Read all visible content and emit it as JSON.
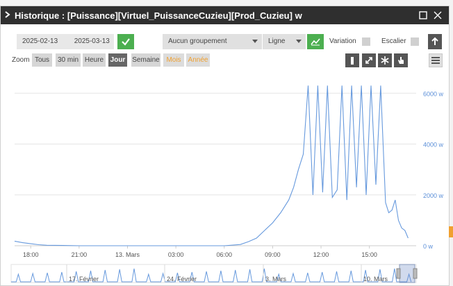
{
  "window": {
    "title": "Historique : [Puissance][Virtuel_PuissanceCuzieu][Prod_Cuzieu] w"
  },
  "filters": {
    "start_date": "2025-02-13",
    "end_date": "2025-03-13",
    "grouping": "Aucun groupement",
    "chart_style": "Ligne",
    "variation_label": "Variation",
    "stair_label": "Escalier"
  },
  "zoom": {
    "label": "Zoom",
    "buttons": [
      "Tous",
      "30 min",
      "Heure",
      "Jour",
      "Semaine",
      "Mois",
      "Année"
    ],
    "active": "Jour"
  },
  "colors": {
    "series": "#6699dd",
    "accent": "#4caf50",
    "title_bg": "#2f2f2f"
  },
  "icons": [
    "chevron-right-icon",
    "maximize-icon",
    "close-icon",
    "check-icon",
    "line-chart-icon",
    "arrow-up-icon",
    "bar-icon",
    "compress-icon",
    "snowflake-icon",
    "hand-icon",
    "menu-icon"
  ],
  "chart_data": {
    "type": "line",
    "title": "",
    "xlabel": "",
    "ylabel": "",
    "x_ticks": [
      "18:00",
      "21:00",
      "13. Mars",
      "03:00",
      "06:00",
      "09:00",
      "12:00",
      "15:00"
    ],
    "y_ticks": [
      "0 w",
      "2000 w",
      "4000 w",
      "6000 w"
    ],
    "ylim": [
      0,
      6500
    ],
    "unit": "w",
    "navigator_ticks": [
      "17. Février",
      "24. Février",
      "3. Mars",
      "10. Mars"
    ],
    "series": [
      {
        "x": [
          -4.0,
          -3.5,
          -3.0,
          -2.5,
          -2.0,
          -1.0,
          0.0,
          1.0,
          2.0,
          3.0,
          4.0,
          5.0,
          6.0,
          7.0,
          8.0,
          9.0,
          10.0,
          10.5,
          11.0,
          11.5,
          12.0,
          12.5,
          13.0,
          13.3,
          13.6,
          13.9,
          14.2,
          14.5,
          14.8,
          15.1,
          15.4,
          15.7,
          16.0,
          16.3,
          16.6,
          16.9,
          17.2,
          17.5,
          17.8,
          18.1,
          18.4,
          18.7,
          19.0,
          19.2,
          19.4,
          19.6,
          19.8,
          20.0,
          20.2,
          20.4
        ],
        "values": [
          180,
          120,
          80,
          40,
          20,
          10,
          0,
          0,
          0,
          0,
          0,
          0,
          0,
          0,
          0,
          0,
          50,
          160,
          300,
          600,
          900,
          1300,
          1800,
          2300,
          3000,
          3600,
          6300,
          2000,
          6300,
          2100,
          6300,
          1900,
          2200,
          6300,
          1800,
          6300,
          2300,
          6300,
          2000,
          6300,
          2400,
          6300,
          1700,
          1300,
          1400,
          1800,
          1000,
          700,
          600,
          300
        ]
      }
    ]
  }
}
